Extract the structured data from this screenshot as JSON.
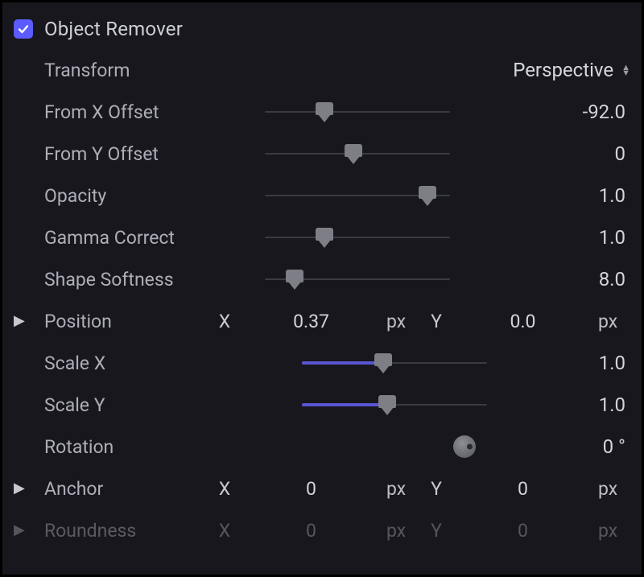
{
  "header": {
    "checked": true,
    "title": "Object Remover"
  },
  "transform": {
    "label": "Transform",
    "value": "Perspective"
  },
  "sliders": {
    "fromXOffset": {
      "label": "From X Offset",
      "value": "-92.0",
      "pct": 32,
      "fill": false
    },
    "fromYOffset": {
      "label": "From Y Offset",
      "value": "0",
      "pct": 48,
      "fill": false
    },
    "opacity": {
      "label": "Opacity",
      "value": "1.0",
      "pct": 88,
      "fill": false
    },
    "gamma": {
      "label": "Gamma Correct",
      "value": "1.0",
      "pct": 32,
      "fill": false
    },
    "softness": {
      "label": "Shape Softness",
      "value": "8.0",
      "pct": 16,
      "fill": false
    },
    "scaleX": {
      "label": "Scale X",
      "value": "1.0",
      "pct": 44,
      "fill": true
    },
    "scaleY": {
      "label": "Scale Y",
      "value": "1.0",
      "pct": 46,
      "fill": true
    }
  },
  "position": {
    "label": "Position",
    "xlabel": "X",
    "xvalue": "0.37",
    "xunit": "px",
    "ylabel": "Y",
    "yvalue": "0.0",
    "yunit": "px"
  },
  "rotation": {
    "label": "Rotation",
    "value": "0"
  },
  "anchor": {
    "label": "Anchor",
    "xlabel": "X",
    "xvalue": "0",
    "xunit": "px",
    "ylabel": "Y",
    "yvalue": "0",
    "yunit": "px"
  },
  "roundness": {
    "label": "Roundness",
    "xlabel": "X",
    "xvalue": "0",
    "xunit": "px",
    "ylabel": "Y",
    "yvalue": "0",
    "yunit": "px"
  }
}
